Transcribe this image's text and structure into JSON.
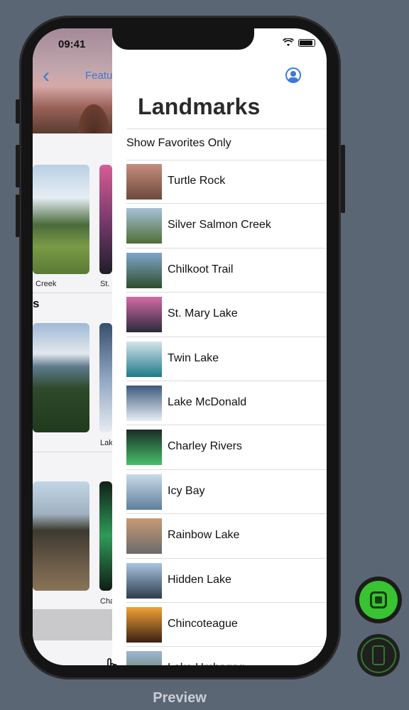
{
  "status": {
    "time": "09:41"
  },
  "background_view": {
    "nav_back_label": "Featured",
    "captions": [
      "Creek",
      "St.",
      "s",
      "Lak",
      "Cha"
    ]
  },
  "sheet": {
    "title": "Landmarks",
    "favorites_toggle_label": "Show Favorites Only",
    "landmarks": [
      {
        "name": "Turtle Rock",
        "thumb_colors": [
          "#c78d7e",
          "#6b4a3c"
        ]
      },
      {
        "name": "Silver Salmon Creek",
        "thumb_colors": [
          "#a7c1d8",
          "#4f6f35"
        ]
      },
      {
        "name": "Chilkoot Trail",
        "thumb_colors": [
          "#7ea6c9",
          "#2f4e2b"
        ]
      },
      {
        "name": "St. Mary Lake",
        "thumb_colors": [
          "#d46aa5",
          "#2b2a3c"
        ]
      },
      {
        "name": "Twin Lake",
        "thumb_colors": [
          "#d6e3ea",
          "#1e7a8c"
        ]
      },
      {
        "name": "Lake McDonald",
        "thumb_colors": [
          "#3d5a7e",
          "#e8eef4"
        ]
      },
      {
        "name": "Charley Rivers",
        "thumb_colors": [
          "#1a2c24",
          "#46c06b"
        ]
      },
      {
        "name": "Icy Bay",
        "thumb_colors": [
          "#c9dbea",
          "#5f7f9c"
        ]
      },
      {
        "name": "Rainbow Lake",
        "thumb_colors": [
          "#c89a74",
          "#6b6b6b"
        ]
      },
      {
        "name": "Hidden Lake",
        "thumb_colors": [
          "#a9c5e0",
          "#2c3c4c"
        ]
      },
      {
        "name": "Chincoteague",
        "thumb_colors": [
          "#f1a238",
          "#3b1f12"
        ]
      },
      {
        "name": "Lake Umbagog",
        "thumb_colors": [
          "#9bb8d2",
          "#5a6b43"
        ]
      }
    ]
  },
  "footer": {
    "preview_label": "Preview"
  },
  "colors": {
    "accent": "#3a7bd5",
    "live_button": "#39c232",
    "page_bg": "#5b6675"
  },
  "icons": [
    "back-chevron",
    "profile",
    "wifi",
    "battery",
    "live-preview",
    "device-preview",
    "hand-cursor"
  ]
}
